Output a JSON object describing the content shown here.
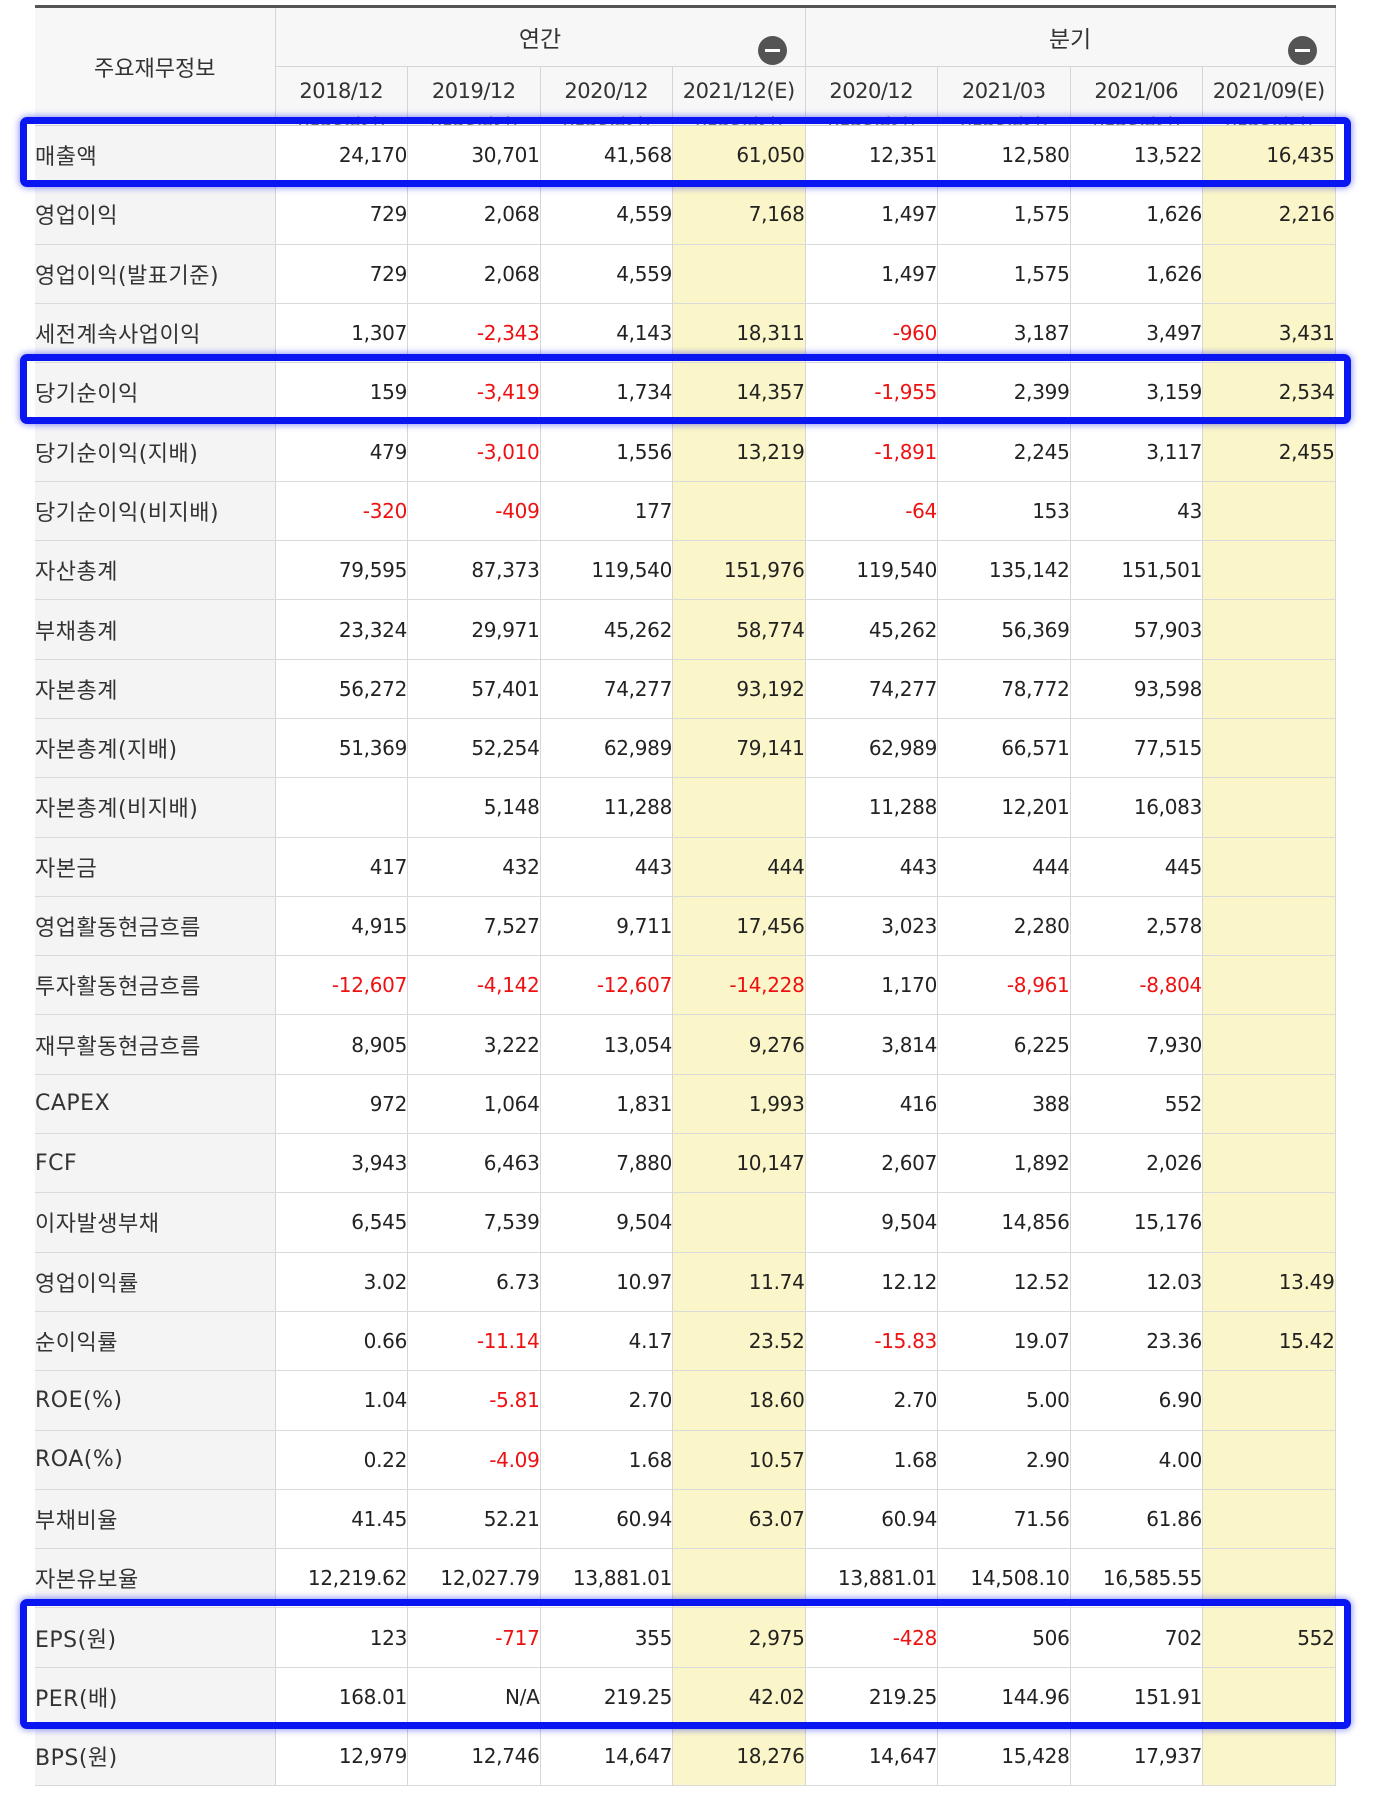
{
  "header": {
    "title": "주요재무정보",
    "group_annual": "연간",
    "group_quarter": "분기",
    "periods": [
      {
        "date": "2018/12",
        "type": "(IFRS연결)"
      },
      {
        "date": "2019/12",
        "type": "(IFRS연결)"
      },
      {
        "date": "2020/12",
        "type": "(IFRS연결)"
      },
      {
        "date": "2021/12(E)",
        "type": "(IFRS연결)"
      },
      {
        "date": "2020/12",
        "type": "(IFRS연결)"
      },
      {
        "date": "2021/03",
        "type": "(IFRS연결)"
      },
      {
        "date": "2021/06",
        "type": "(IFRS연결)"
      },
      {
        "date": "2021/09(E)",
        "type": "(IFRS연결)"
      }
    ],
    "estimate_columns": [
      3,
      7
    ]
  },
  "colors": {
    "estimate_bg": "#fbf6c9",
    "negative_text": "#ee1111",
    "highlight_border": "#0a16f2",
    "label_bg": "#f4f4f4"
  },
  "rows": [
    {
      "label": "매출액",
      "sub": false,
      "values": [
        "24,170",
        "30,701",
        "41,568",
        "61,050",
        "12,351",
        "12,580",
        "13,522",
        "16,435"
      ]
    },
    {
      "label": "영업이익",
      "sub": false,
      "values": [
        "729",
        "2,068",
        "4,559",
        "7,168",
        "1,497",
        "1,575",
        "1,626",
        "2,216"
      ]
    },
    {
      "label": "영업이익(발표기준)",
      "sub": false,
      "values": [
        "729",
        "2,068",
        "4,559",
        "",
        "1,497",
        "1,575",
        "1,626",
        ""
      ]
    },
    {
      "label": "세전계속사업이익",
      "sub": false,
      "values": [
        "1,307",
        "-2,343",
        "4,143",
        "18,311",
        "-960",
        "3,187",
        "3,497",
        "3,431"
      ]
    },
    {
      "label": "당기순이익",
      "sub": false,
      "values": [
        "159",
        "-3,419",
        "1,734",
        "14,357",
        "-1,955",
        "2,399",
        "3,159",
        "2,534"
      ]
    },
    {
      "label": "당기순이익(지배)",
      "sub": true,
      "values": [
        "479",
        "-3,010",
        "1,556",
        "13,219",
        "-1,891",
        "2,245",
        "3,117",
        "2,455"
      ]
    },
    {
      "label": "당기순이익(비지배)",
      "sub": true,
      "values": [
        "-320",
        "-409",
        "177",
        "",
        "-64",
        "153",
        "43",
        ""
      ]
    },
    {
      "label": "자산총계",
      "sub": false,
      "values": [
        "79,595",
        "87,373",
        "119,540",
        "151,976",
        "119,540",
        "135,142",
        "151,501",
        ""
      ]
    },
    {
      "label": "부채총계",
      "sub": false,
      "values": [
        "23,324",
        "29,971",
        "45,262",
        "58,774",
        "45,262",
        "56,369",
        "57,903",
        ""
      ]
    },
    {
      "label": "자본총계",
      "sub": false,
      "values": [
        "56,272",
        "57,401",
        "74,277",
        "93,192",
        "74,277",
        "78,772",
        "93,598",
        ""
      ]
    },
    {
      "label": "자본총계(지배)",
      "sub": true,
      "values": [
        "51,369",
        "52,254",
        "62,989",
        "79,141",
        "62,989",
        "66,571",
        "77,515",
        ""
      ]
    },
    {
      "label": "자본총계(비지배)",
      "sub": true,
      "values": [
        "",
        "5,148",
        "11,288",
        "",
        "11,288",
        "12,201",
        "16,083",
        ""
      ]
    },
    {
      "label": "자본금",
      "sub": false,
      "values": [
        "417",
        "432",
        "443",
        "444",
        "443",
        "444",
        "445",
        ""
      ]
    },
    {
      "label": "영업활동현금흐름",
      "sub": false,
      "values": [
        "4,915",
        "7,527",
        "9,711",
        "17,456",
        "3,023",
        "2,280",
        "2,578",
        ""
      ]
    },
    {
      "label": "투자활동현금흐름",
      "sub": false,
      "values": [
        "-12,607",
        "-4,142",
        "-12,607",
        "-14,228",
        "1,170",
        "-8,961",
        "-8,804",
        ""
      ]
    },
    {
      "label": "재무활동현금흐름",
      "sub": false,
      "values": [
        "8,905",
        "3,222",
        "13,054",
        "9,276",
        "3,814",
        "6,225",
        "7,930",
        ""
      ]
    },
    {
      "label": "CAPEX",
      "sub": false,
      "values": [
        "972",
        "1,064",
        "1,831",
        "1,993",
        "416",
        "388",
        "552",
        ""
      ]
    },
    {
      "label": "FCF",
      "sub": false,
      "values": [
        "3,943",
        "6,463",
        "7,880",
        "10,147",
        "2,607",
        "1,892",
        "2,026",
        ""
      ]
    },
    {
      "label": "이자발생부채",
      "sub": false,
      "values": [
        "6,545",
        "7,539",
        "9,504",
        "",
        "9,504",
        "14,856",
        "15,176",
        ""
      ]
    },
    {
      "label": "영업이익률",
      "sub": false,
      "values": [
        "3.02",
        "6.73",
        "10.97",
        "11.74",
        "12.12",
        "12.52",
        "12.03",
        "13.49"
      ]
    },
    {
      "label": "순이익률",
      "sub": false,
      "values": [
        "0.66",
        "-11.14",
        "4.17",
        "23.52",
        "-15.83",
        "19.07",
        "23.36",
        "15.42"
      ]
    },
    {
      "label": "ROE(%)",
      "sub": false,
      "values": [
        "1.04",
        "-5.81",
        "2.70",
        "18.60",
        "2.70",
        "5.00",
        "6.90",
        ""
      ]
    },
    {
      "label": "ROA(%)",
      "sub": false,
      "values": [
        "0.22",
        "-4.09",
        "1.68",
        "10.57",
        "1.68",
        "2.90",
        "4.00",
        ""
      ]
    },
    {
      "label": "부채비율",
      "sub": false,
      "values": [
        "41.45",
        "52.21",
        "60.94",
        "63.07",
        "60.94",
        "71.56",
        "61.86",
        ""
      ]
    },
    {
      "label": "자본유보율",
      "sub": false,
      "values": [
        "12,219.62",
        "12,027.79",
        "13,881.01",
        "",
        "13,881.01",
        "14,508.10",
        "16,585.55",
        ""
      ]
    },
    {
      "label": "EPS(원)",
      "sub": false,
      "values": [
        "123",
        "-717",
        "355",
        "2,975",
        "-428",
        "506",
        "702",
        "552"
      ]
    },
    {
      "label": "PER(배)",
      "sub": false,
      "values": [
        "168.01",
        "N/A",
        "219.25",
        "42.02",
        "219.25",
        "144.96",
        "151.91",
        ""
      ]
    },
    {
      "label": "BPS(원)",
      "sub": false,
      "values": [
        "12,979",
        "12,746",
        "14,647",
        "18,276",
        "14,647",
        "15,428",
        "17,937",
        ""
      ]
    }
  ],
  "highlighted_rows": [
    [
      "매출액"
    ],
    [
      "당기순이익"
    ],
    [
      "EPS(원)",
      "PER(배)"
    ]
  ]
}
